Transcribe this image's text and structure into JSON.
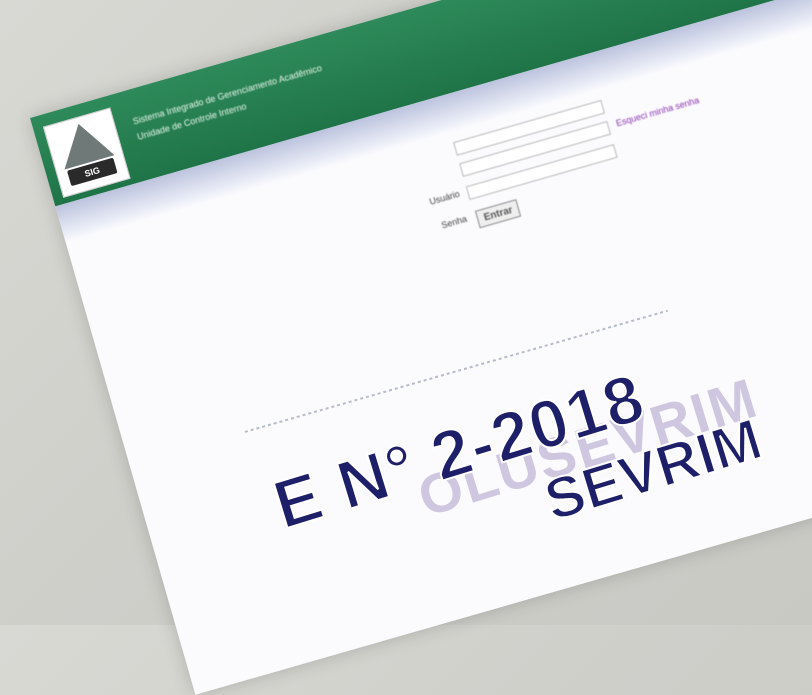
{
  "header": {
    "title": "Sistema Integrado de Gerenciamento Acadêmico",
    "subtitle": "Unidade de Controle Interno",
    "logo_text": "SIG"
  },
  "login": {
    "user_label": "Usuário",
    "password_label": "Senha",
    "forgot_link": "Esqueci minha senha",
    "enter_button": "Entrar"
  },
  "background_text": {
    "line1": "E N° 2-2018",
    "line2": "SEVRIM",
    "ghost": "OLUSEVRIM"
  }
}
